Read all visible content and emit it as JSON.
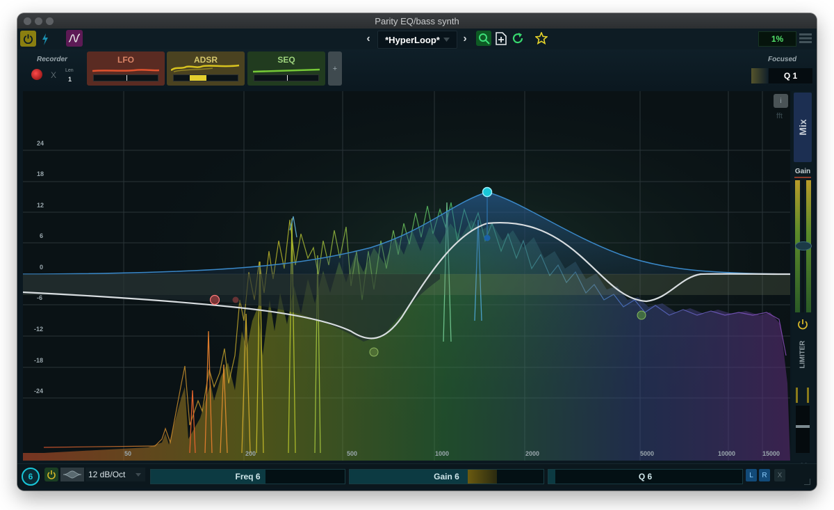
{
  "window": {
    "title": "Parity EQ/bass synth"
  },
  "toolbar": {
    "preset_name": "*HyperLoop*",
    "prev_label": "‹",
    "next_label": "›",
    "cpu_label": "1%"
  },
  "recorder": {
    "label": "Recorder",
    "clear_label": "X",
    "len_label": "Len",
    "len_value": "1"
  },
  "modulators": [
    {
      "label": "LFO",
      "color": "#d9572f"
    },
    {
      "label": "ADSR",
      "color": "#d4c12a"
    },
    {
      "label": "SEQ",
      "color": "#77c93a"
    }
  ],
  "add_label": "+",
  "focused": {
    "label": "Focused",
    "value": "Q 1"
  },
  "graph": {
    "y_ticks": [
      "24",
      "18",
      "12",
      "6",
      "0",
      "-6",
      "-12",
      "-18",
      "-24"
    ],
    "x_ticks": [
      "50",
      "200",
      "500",
      "1000",
      "2000",
      "5000",
      "10000",
      "15000"
    ],
    "info_label": "i",
    "fft_label": "fft"
  },
  "right": {
    "mix_label": "Mix",
    "gain_label": "Gain",
    "limiter_label": "LIMITER",
    "collapse_label": "<<"
  },
  "bottom": {
    "band_number": "6",
    "slope": "12 dB/Oct",
    "freq_label": "Freq 6",
    "gain_label": "Gain 6",
    "q_label": "Q 6",
    "l_label": "L",
    "r_label": "R",
    "close_label": "X"
  },
  "colors": {
    "accent": "#19c6d8",
    "background": "#0b1820",
    "eq_curve": "#d8dde0",
    "yellow": "#e7d21c"
  }
}
